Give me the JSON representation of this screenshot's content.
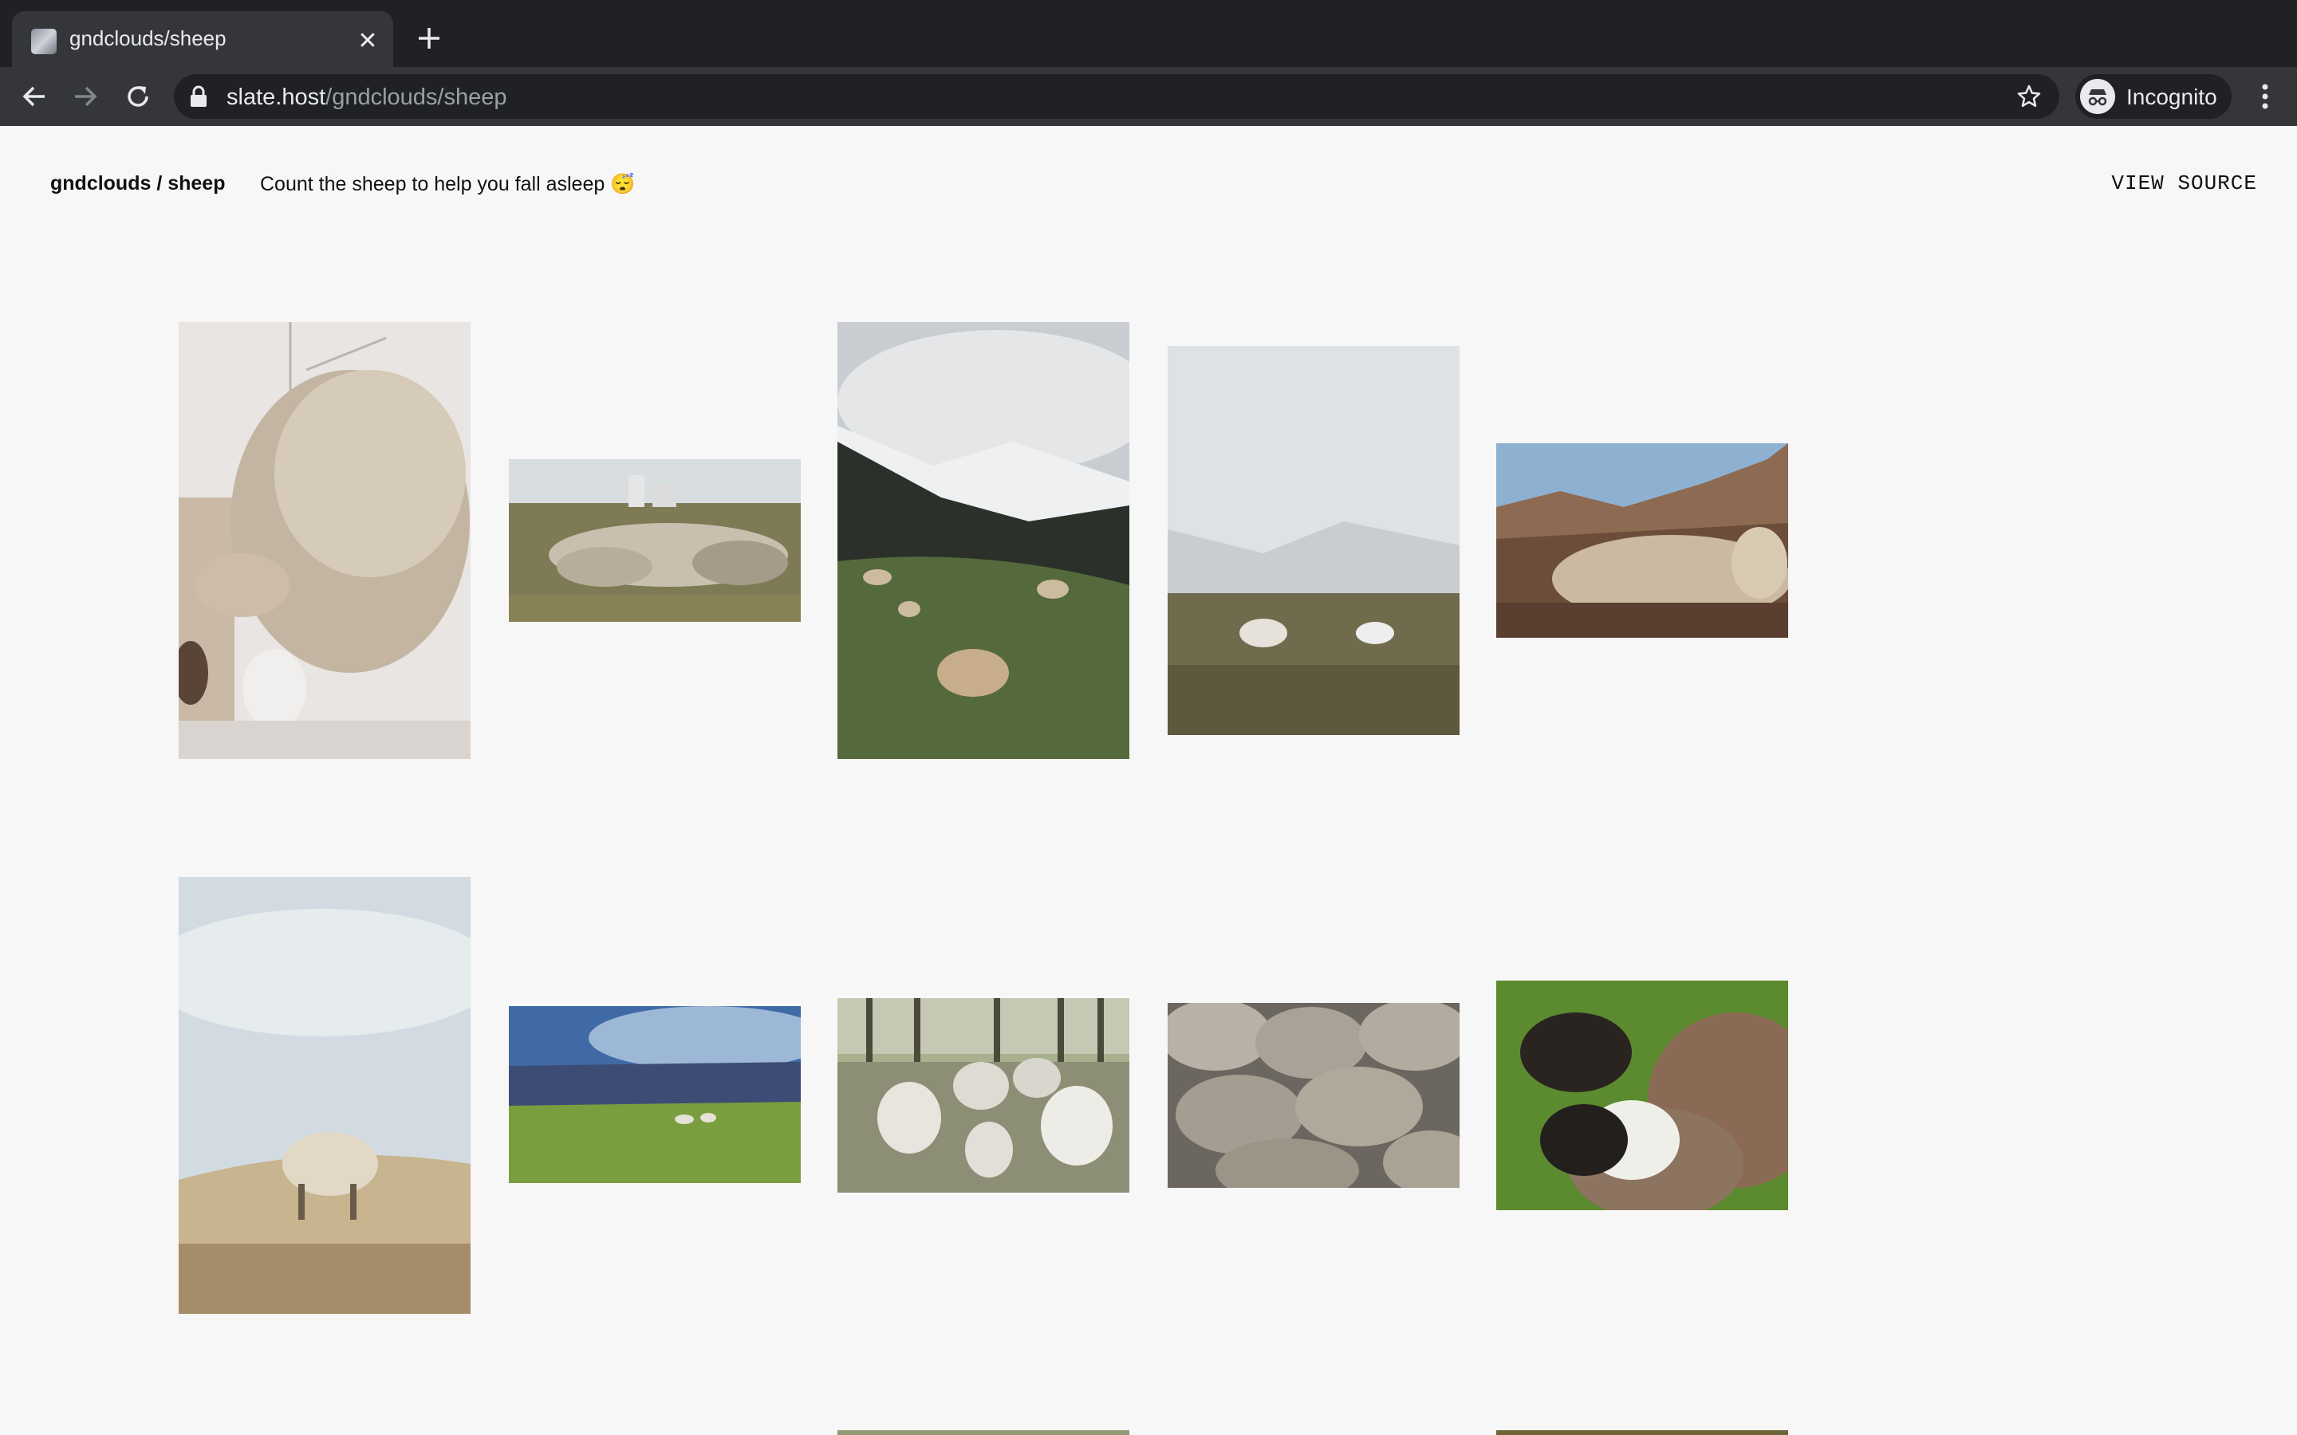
{
  "browser": {
    "tab_title": "gndclouds/sheep",
    "url_host": "slate.host",
    "url_path": "/gndclouds/sheep",
    "profile_label": "Incognito"
  },
  "slate": {
    "title": "gndclouds / sheep",
    "description": "Count the sheep to help you fall asleep 😴",
    "view_source_label": "VIEW SOURCE"
  },
  "photos": [
    {
      "subject": "close-up sheep portrait"
    },
    {
      "subject": "flock in field with factory"
    },
    {
      "subject": "sheep grazing below snowy mountain"
    },
    {
      "subject": "sheep on misty plain"
    },
    {
      "subject": "flock in desert canyon"
    },
    {
      "subject": "lone sheep on grassy hill"
    },
    {
      "subject": "sheep on green pasture with blue sky"
    },
    {
      "subject": "sheep walking toward camera"
    },
    {
      "subject": "crowded flock from above"
    },
    {
      "subject": "two black-faced sheep on grass"
    },
    {
      "subject": "partial photo"
    },
    {
      "subject": "partial photo"
    }
  ]
}
